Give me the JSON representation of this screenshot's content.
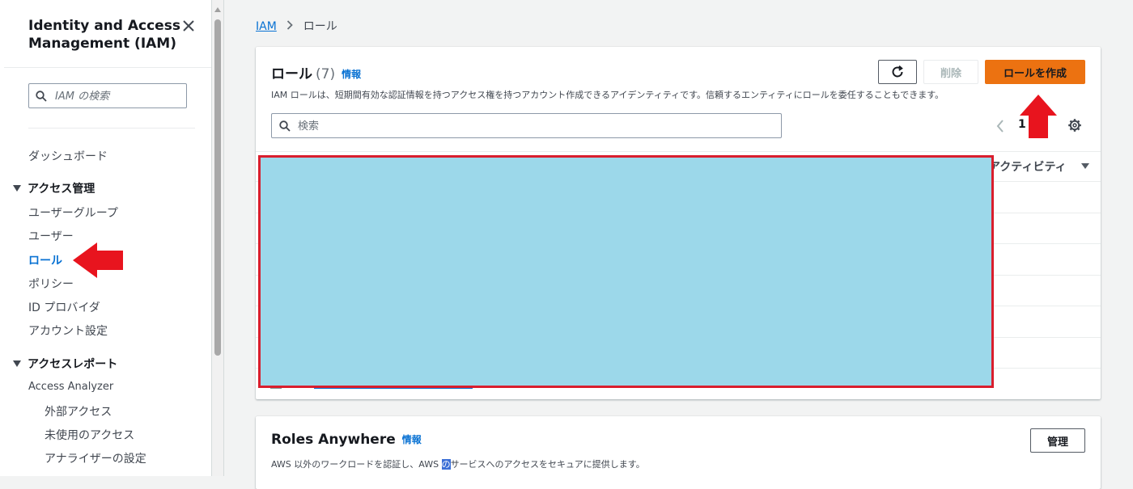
{
  "sidebar": {
    "title": "Identity and Access Management (IAM)",
    "search_placeholder": "IAM の検索",
    "dashboard": "ダッシュボード",
    "access_management": {
      "label": "アクセス管理",
      "items": [
        "ユーザーグループ",
        "ユーザー",
        "ロール",
        "ポリシー",
        "ID プロバイダ",
        "アカウント設定"
      ],
      "active_item": "ロール"
    },
    "access_reports": {
      "label": "アクセスレポート",
      "analyzer": "Access Analyzer",
      "analyzer_items": [
        "外部アクセス",
        "未使用のアクセス",
        "アナライザーの設定"
      ]
    }
  },
  "breadcrumb": {
    "root": "IAM",
    "current": "ロール"
  },
  "roles_panel": {
    "title": "ロール",
    "count": "(7)",
    "info": "情報",
    "description": "IAM ロールは、短期間有効な認証情報を持つアクセス権を持つアカウント作成できるアイデンティティです。信頼するエンティティにロールを委任することもできます。",
    "refresh_icon": "refresh-icon",
    "delete_label": "削除",
    "create_label": "ロールを作成",
    "search_placeholder": "検索",
    "page_number": "1",
    "column_activity": "アクティビティ"
  },
  "roles_anywhere": {
    "title": "Roles Anywhere",
    "info": "情報",
    "description_pre": "AWS 以外のワークロードを認証し、AWS ",
    "description_highlight": "の",
    "description_post": "サービスへのアクセスをセキュアに提供します。",
    "manage_label": "管理"
  },
  "colors": {
    "primary_button": "#ec7211",
    "link": "#0972d3",
    "annotation_arrow": "#e8141e",
    "redaction_fill": "#9cd8ea",
    "redaction_border": "#d91e2d"
  }
}
